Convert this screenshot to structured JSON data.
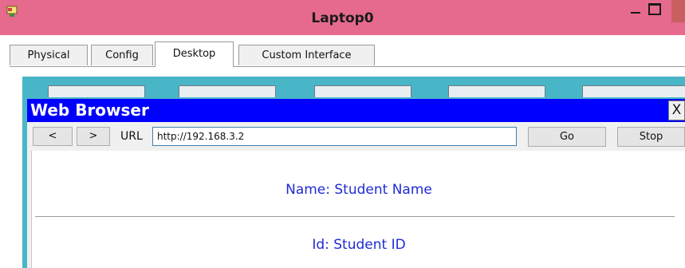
{
  "window": {
    "title": "Laptop0"
  },
  "tabs": [
    {
      "label": "Physical"
    },
    {
      "label": "Config"
    },
    {
      "label": "Desktop",
      "active": true
    },
    {
      "label": "Custom Interface"
    }
  ],
  "browser": {
    "title": "Web Browser",
    "close_label": "X",
    "back_label": "<",
    "forward_label": ">",
    "url_label": "URL",
    "url_value": "http://192.168.3.2",
    "go_label": "Go",
    "stop_label": "Stop",
    "page": {
      "name_line": "Name: Student Name",
      "id_line": "Id: Student ID"
    }
  },
  "colors": {
    "titlebar": "#e56a8e",
    "desktop": "#49b6c8",
    "browser_title": "#0000ff",
    "page_text": "#1f2ad6"
  },
  "icons": [
    "app-icon",
    "minimize-icon",
    "maximize-icon",
    "close-icon"
  ]
}
